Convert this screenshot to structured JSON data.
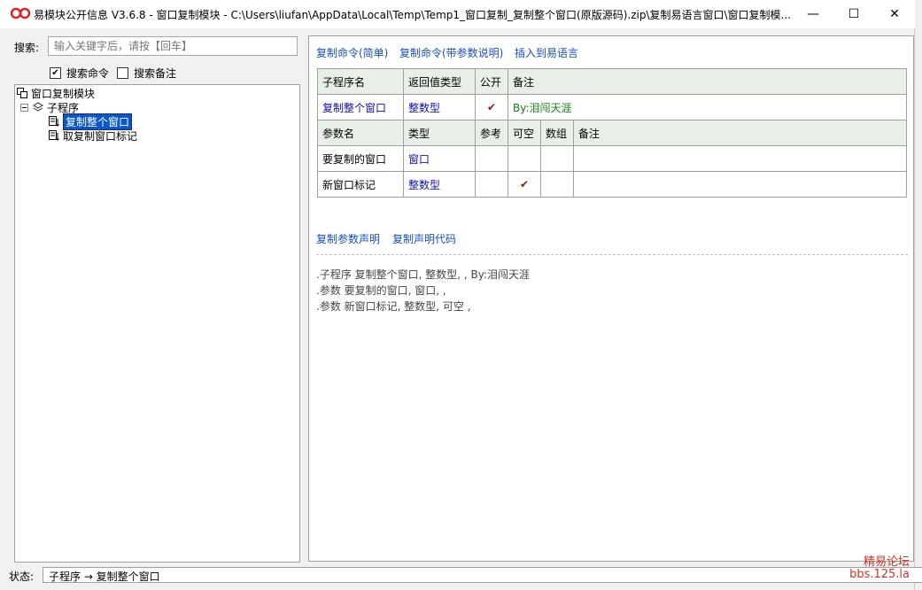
{
  "title": "易模块公开信息 V3.6.8 - 窗口复制模块 - C:\\Users\\liufan\\AppData\\Local\\Temp\\Temp1_窗口复制_复制整个窗口(原版源码).zip\\复制易语言窗口\\窗口复制模...",
  "window_controls": {
    "minimize": "—",
    "maximize": "☐",
    "close": "✕"
  },
  "search": {
    "label": "搜索:",
    "placeholder": "输入关键字后，请按【回车】"
  },
  "options": {
    "search_commands": "搜索命令",
    "search_comments": "搜索备注"
  },
  "tree": {
    "root": "窗口复制模块",
    "group": "子程序",
    "items": [
      "复制整个窗口",
      "取复制窗口标记"
    ]
  },
  "links_top": {
    "copy_simple": "复制命令(简单)",
    "copy_with_params": "复制命令(带参数说明)",
    "insert": "插入到易语言"
  },
  "proc_table": {
    "headers": [
      "子程序名",
      "返回值类型",
      "公开",
      "备注"
    ],
    "row": {
      "name": "复制整个窗口",
      "return_type": "整数型",
      "public": "✔",
      "note": "By:泪闯天涯"
    }
  },
  "param_table": {
    "headers": [
      "参数名",
      "类型",
      "参考",
      "可空",
      "数组",
      "备注"
    ],
    "rows": [
      {
        "name": "要复制的窗口",
        "type": "窗口",
        "ref": "",
        "nullable": "",
        "array": "",
        "note": ""
      },
      {
        "name": "新窗口标记",
        "type": "整数型",
        "ref": "",
        "nullable": "✔",
        "array": "",
        "note": ""
      }
    ]
  },
  "links_bottom": {
    "copy_param_decl": "复制参数声明",
    "copy_decl_code": "复制声明代码"
  },
  "code_lines": [
    ".子程序 复制整个窗口, 整数型, , By:泪闯天涯",
    ".参数 要复制的窗口, 窗口, ,",
    ".参数 新窗口标记, 整数型, 可空 ,"
  ],
  "status": {
    "label": "状态:",
    "text": "子程序 → 复制整个窗口"
  },
  "watermark": {
    "line1": "精易论坛",
    "line2": "bbs.125.la"
  }
}
